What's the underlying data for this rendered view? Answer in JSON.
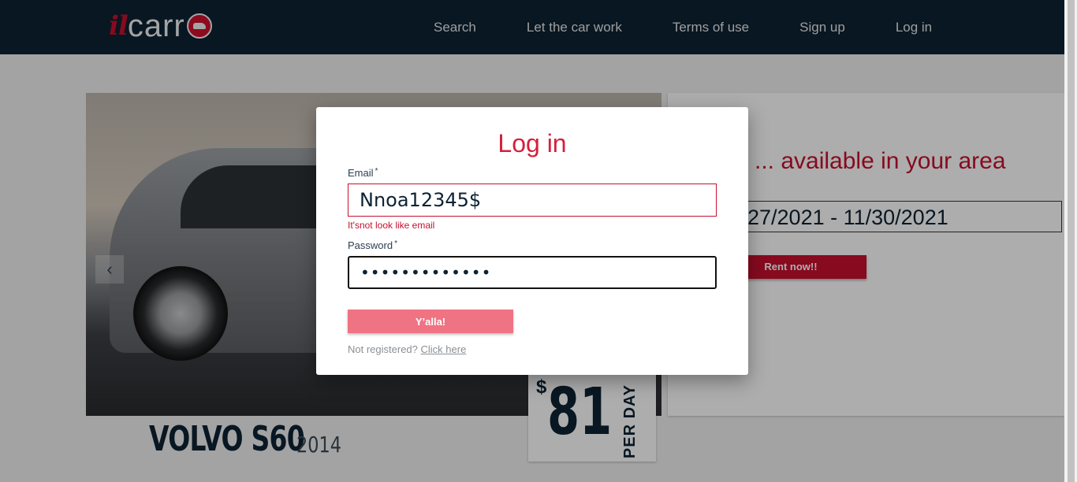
{
  "header": {
    "logo": {
      "part1": "il",
      "part2": "carr"
    },
    "nav": [
      {
        "label": "Search"
      },
      {
        "label": "Let the car work"
      },
      {
        "label": "Terms of use"
      },
      {
        "label": "Sign up"
      },
      {
        "label": "Log in"
      }
    ]
  },
  "background": {
    "car_model": "VOLVO S60",
    "car_year": "2014",
    "price_currency": "$",
    "price_value": "81",
    "price_period": "PER DAY",
    "available_text": "... available in your area",
    "date_range": "27/2021 - 11/30/2021",
    "rent_button": "Rent now!!"
  },
  "modal": {
    "title": "Log in",
    "email_label": "Email",
    "email_value": "Nnoa12345$",
    "email_error": "It'snot look like email",
    "password_label": "Password",
    "password_value": "•••••••••••••",
    "required_mark": "*",
    "submit_label": "Y’alla!",
    "not_registered": "Not registered?",
    "click_here": "Click here"
  },
  "colors": {
    "header_bg": "#0d2233",
    "accent": "#c8102e",
    "submit_bg": "#f07383"
  }
}
